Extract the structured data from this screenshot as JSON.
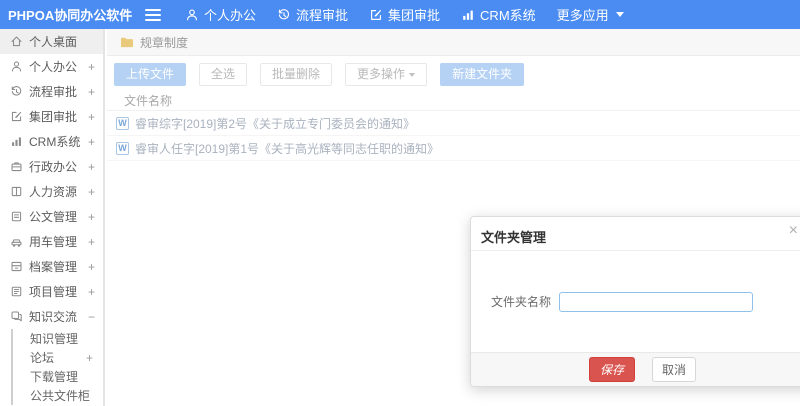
{
  "topbar": {
    "logo": "PHPOA协同办公软件",
    "nav": [
      {
        "label": "个人办公"
      },
      {
        "label": "流程审批"
      },
      {
        "label": "集团审批"
      },
      {
        "label": "CRM系统"
      },
      {
        "label": "更多应用"
      }
    ]
  },
  "sidebar": {
    "items": [
      {
        "label": "个人桌面",
        "expand": ""
      },
      {
        "label": "个人办公",
        "expand": "+"
      },
      {
        "label": "流程审批",
        "expand": "+"
      },
      {
        "label": "集团审批",
        "expand": "+"
      },
      {
        "label": "CRM系统",
        "expand": "+"
      },
      {
        "label": "行政办公",
        "expand": "+"
      },
      {
        "label": "人力资源",
        "expand": "+"
      },
      {
        "label": "公文管理",
        "expand": "+"
      },
      {
        "label": "用车管理",
        "expand": "+"
      },
      {
        "label": "档案管理",
        "expand": "+"
      },
      {
        "label": "项目管理",
        "expand": "+"
      },
      {
        "label": "知识交流",
        "expand": "−"
      }
    ],
    "submenu": [
      {
        "label": "知识管理",
        "expand": ""
      },
      {
        "label": "论坛",
        "expand": "+"
      },
      {
        "label": "下载管理",
        "expand": ""
      },
      {
        "label": "公共文件柜",
        "expand": ""
      }
    ]
  },
  "breadcrumb": {
    "label": "规章制度"
  },
  "toolbar": {
    "upload": "上传文件",
    "select_all": "全选",
    "batch_delete": "批量删除",
    "more_actions": "更多操作",
    "new_folder": "新建文件夹"
  },
  "file_table": {
    "header": "文件名称",
    "doc_icon": "W",
    "rows": [
      {
        "name": "睿审综字[2019]第2号《关于成立专门委员会的通知》"
      },
      {
        "name": "睿审人任字[2019]第1号《关于高光辉等同志任职的通知》"
      }
    ]
  },
  "modal": {
    "title": "文件夹管理",
    "close": "×",
    "field_label": "文件夹名称",
    "input_value": "",
    "save": "保存",
    "cancel": "取消"
  },
  "colors": {
    "topbar_blue": "#4b8cf2",
    "save_red": "#d9534f",
    "primary_button_muted": "#b5d2f4",
    "folder_yellow": "#e9c97b",
    "input_focus_border": "#8fc0ea"
  }
}
